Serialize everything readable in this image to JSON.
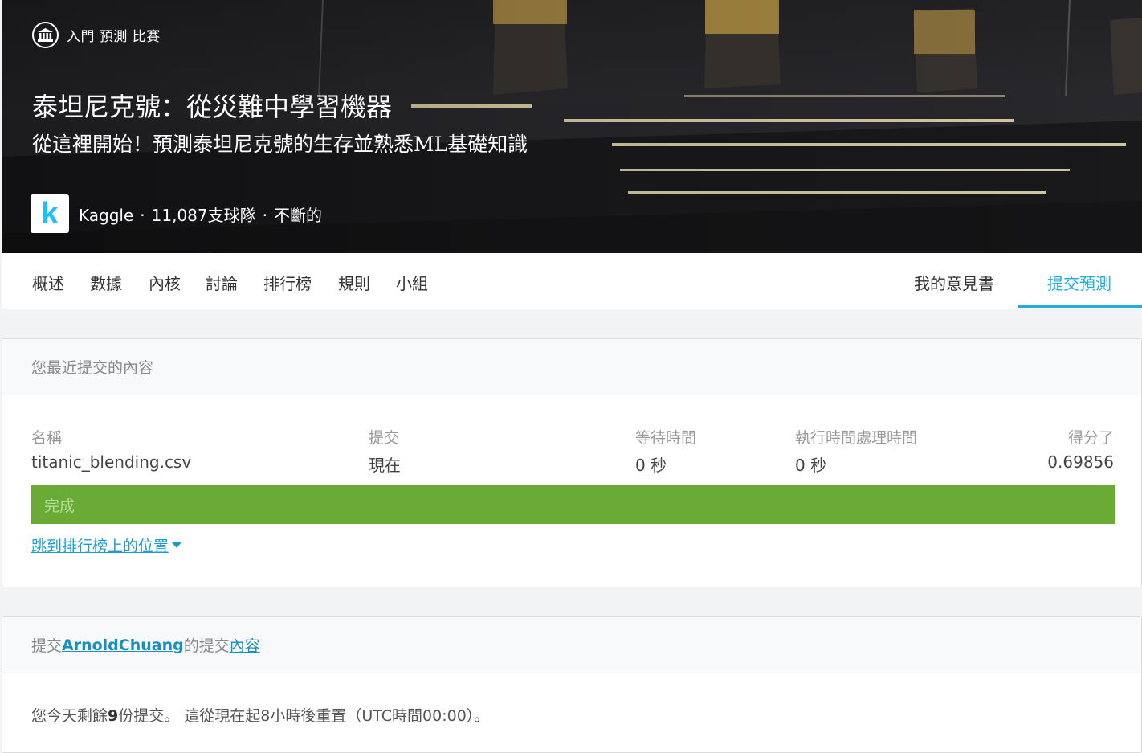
{
  "competition": {
    "tier": "入門 預測 比賽",
    "title": "泰坦尼克號：從災難中學習機器",
    "subtitle": "從這裡開始！預測泰坦尼克號的生存並熟悉ML基礎知識",
    "host": "Kaggle",
    "host_logo_letter": "k",
    "teams": "11,087支球隊",
    "status": "不斷的",
    "separator": "·"
  },
  "nav": {
    "tabs": [
      "概述",
      "數據",
      "內核",
      "討論",
      "排行榜",
      "規則",
      "小組"
    ],
    "my_notes": "我的意見書",
    "submit": "提交預測"
  },
  "recent": {
    "heading": "您最近提交的內容",
    "columns": {
      "name_label": "名稱",
      "name_value": "titanic_blending.csv",
      "submitted_label": "提交",
      "submitted_value": "現在",
      "wait_label": "等待時間",
      "wait_value": "0 秒",
      "exec_label": "執行時間處理時間",
      "exec_value": "0 秒",
      "score_label": "得分了",
      "score_value": "0.69856"
    },
    "status": "完成",
    "jump_link": "跳到排行榜上的位置"
  },
  "submit_panel": {
    "heading_prefix": "提交",
    "user": "ArnoldChuang",
    "heading_mid": "的提交",
    "heading_link": "內容",
    "remaining_prefix": "您今天剩餘",
    "remaining_count": "9",
    "remaining_suffix": "份提交。 這從現在起8小時後重置（UTC時間00:00）。"
  },
  "colors": {
    "accent": "#20aedb",
    "complete": "#6aab35"
  }
}
